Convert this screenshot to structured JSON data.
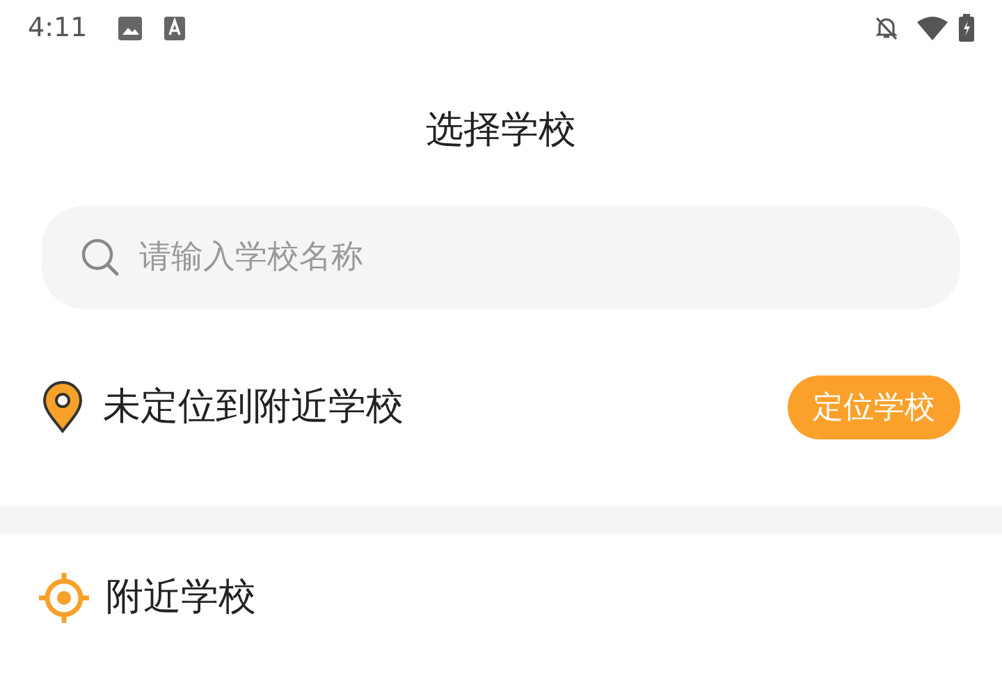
{
  "status_bar": {
    "time": "4:11"
  },
  "header": {
    "title": "选择学校"
  },
  "search": {
    "placeholder": "请输入学校名称"
  },
  "location": {
    "message": "未定位到附近学校",
    "button": "定位学校"
  },
  "nearby": {
    "title": "附近学校"
  }
}
